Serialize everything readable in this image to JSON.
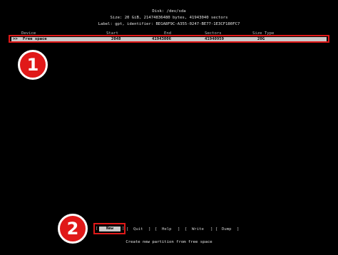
{
  "header": {
    "disk": "Disk: /dev/sda",
    "size": "Size: 20 GiB, 21474836480 bytes, 41943040 sectors",
    "label": "Label: gpt, identifier: BD1A8F9C-A355-0247-BE77-1E3CF180FC7"
  },
  "table": {
    "columns": {
      "device": "Device",
      "start": "Start",
      "end": "End",
      "sectors": "Sectors",
      "size": "Size Type"
    },
    "selected_row": {
      "cursor": ">>",
      "name": "Free space",
      "start": "2048",
      "end": "41943006",
      "sectors": "41940959",
      "size": "20G"
    }
  },
  "annotations": {
    "badge1": "1",
    "badge2": "2"
  },
  "menu": {
    "open_bracket": "[",
    "close_bracket": "]",
    "new": "New",
    "quit": "Quit",
    "help": "Help",
    "write": "Write",
    "dump": "Dump"
  },
  "status": "Create new partition from free space",
  "colors": {
    "highlight": "#e01919",
    "selection": "#c9c9c9",
    "background": "#000000"
  }
}
